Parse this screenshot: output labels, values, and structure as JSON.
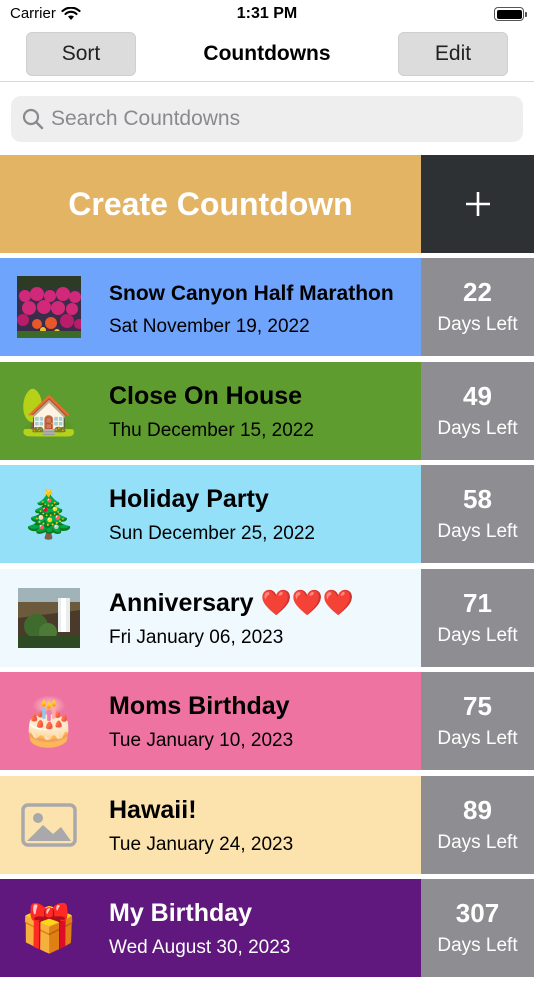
{
  "status_bar": {
    "carrier": "Carrier",
    "time": "1:31 PM"
  },
  "nav": {
    "sort_label": "Sort",
    "title": "Countdowns",
    "edit_label": "Edit"
  },
  "search": {
    "placeholder": "Search Countdowns",
    "value": ""
  },
  "create": {
    "label": "Create Countdown",
    "icon": "plus-icon",
    "label_bg": "#e4b465",
    "icon_bg": "#2e3133"
  },
  "countdowns": [
    {
      "title": "Snow Canyon Half Marathon",
      "date": "Sat November 19, 2022",
      "days": "22",
      "days_label": "Days Left",
      "color": "#6fa4fc",
      "text_color": "#000000",
      "image": "flower-photo"
    },
    {
      "title": "Close On House",
      "date": "Thu December 15, 2022",
      "days": "49",
      "days_label": "Days Left",
      "color": "#5e9c2f",
      "text_color": "#000000",
      "image": "house-emoji",
      "emoji": "🏡"
    },
    {
      "title": "Holiday Party",
      "date": "Sun December 25, 2022",
      "days": "58",
      "days_label": "Days Left",
      "color": "#93e0f8",
      "text_color": "#000000",
      "image": "christmas-tree-emoji",
      "emoji": "🎄"
    },
    {
      "title": "Anniversary ❤️❤️❤️",
      "date": "Fri January 06, 2023",
      "days": "71",
      "days_label": "Days Left",
      "color": "#f0f9fd",
      "text_color": "#000000",
      "image": "waterfall-photo"
    },
    {
      "title": "Moms Birthday",
      "date": "Tue January 10, 2023",
      "days": "75",
      "days_label": "Days Left",
      "color": "#ef73a0",
      "text_color": "#000000",
      "image": "cake-emoji",
      "emoji": "🎂"
    },
    {
      "title": "Hawaii!",
      "date": "Tue January 24, 2023",
      "days": "89",
      "days_label": "Days Left",
      "color": "#fce2ad",
      "text_color": "#000000",
      "image": "image-placeholder-icon"
    },
    {
      "title": "My Birthday",
      "date": "Wed August 30, 2023",
      "days": "307",
      "days_label": "Days Left",
      "color": "#60177e",
      "text_color": "#ffffff",
      "image": "gift-emoji",
      "emoji": "🎁"
    }
  ],
  "days_cell_color": "#8e8e92"
}
